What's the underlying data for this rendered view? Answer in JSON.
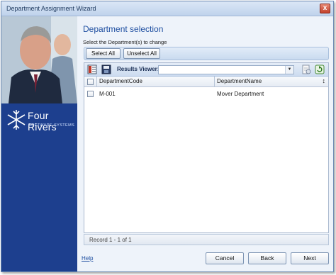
{
  "window": {
    "title": "Department Assignment Wizard",
    "close_glyph": "x"
  },
  "branding": {
    "company_name": "Four Rivers",
    "company_tagline": "SOFTWARE SYSTEMS",
    "logo_icon": "snowflake-logo-icon",
    "photo": "business-people-photo"
  },
  "page": {
    "heading": "Department selection",
    "instruction": "Select the Department(s) to change"
  },
  "selection_buttons": {
    "select_all": "Select All",
    "unselect_all": "Unselect All"
  },
  "grid": {
    "toolbar": {
      "results_viewer_label": "Results Viewer:",
      "results_viewer_value": "",
      "icons": [
        "grid-layout-icon",
        "save-icon",
        "export-icon",
        "refresh-icon"
      ]
    },
    "columns": [
      "DepartmentCode",
      "DepartmentName"
    ],
    "sort_icon_glyph": "↕",
    "rows": [
      {
        "checked": false,
        "code": "M-001",
        "name": "Mover Department"
      }
    ],
    "record_status": "Record 1 - 1 of 1"
  },
  "footer": {
    "help": "Help",
    "cancel": "Cancel",
    "back": "Back",
    "next": "Next"
  },
  "colors": {
    "accent": "#1f4fa1",
    "left_panel": "#1d3f8e",
    "close_button": "#c2412b"
  }
}
